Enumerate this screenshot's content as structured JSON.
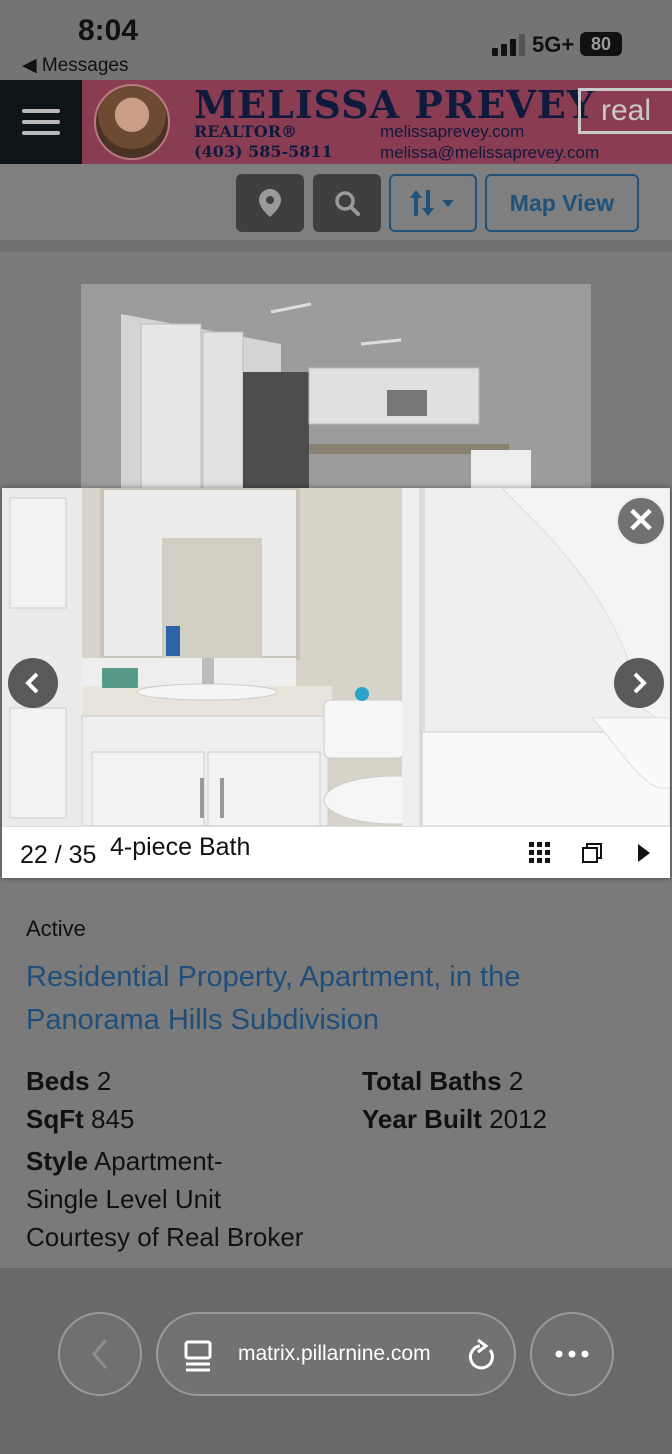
{
  "status_bar": {
    "time": "8:04",
    "back_app": "◀ Messages",
    "network": "5G+",
    "battery": "80"
  },
  "banner": {
    "agent_name": "MELISSA PREVEY",
    "title": "REALTOR®",
    "phone": "(403) 585-5811",
    "website": "melissaprevey.com",
    "email": "melissa@melissaprevey.com",
    "brand": "real"
  },
  "toolbar": {
    "map_view_label": "Map View",
    "icons": [
      "map-pin-icon",
      "search-icon",
      "sort-icon"
    ]
  },
  "gallery": {
    "counter": "22 / 35",
    "caption": "4-piece Bath",
    "close_symbol": "✕"
  },
  "listing": {
    "status": "Active",
    "title": "Residential Property, Apartment, in the Panorama Hills Subdivision",
    "beds_label": "Beds",
    "beds_value": "2",
    "sqft_label": "SqFt",
    "sqft_value": "845",
    "style_label": "Style",
    "style_value": "Apartment-Single Level Unit",
    "total_baths_label": "Total Baths",
    "total_baths_value": "2",
    "year_built_label": "Year Built",
    "year_built_value": "2012",
    "courtesy": "Courtesy of Real Broker"
  },
  "browser": {
    "url": "matrix.pillarnine.com"
  },
  "colors": {
    "banner_pink": "#8a3d52",
    "link_blue": "#1f4e7b",
    "menu_dark": "#0e1518"
  }
}
